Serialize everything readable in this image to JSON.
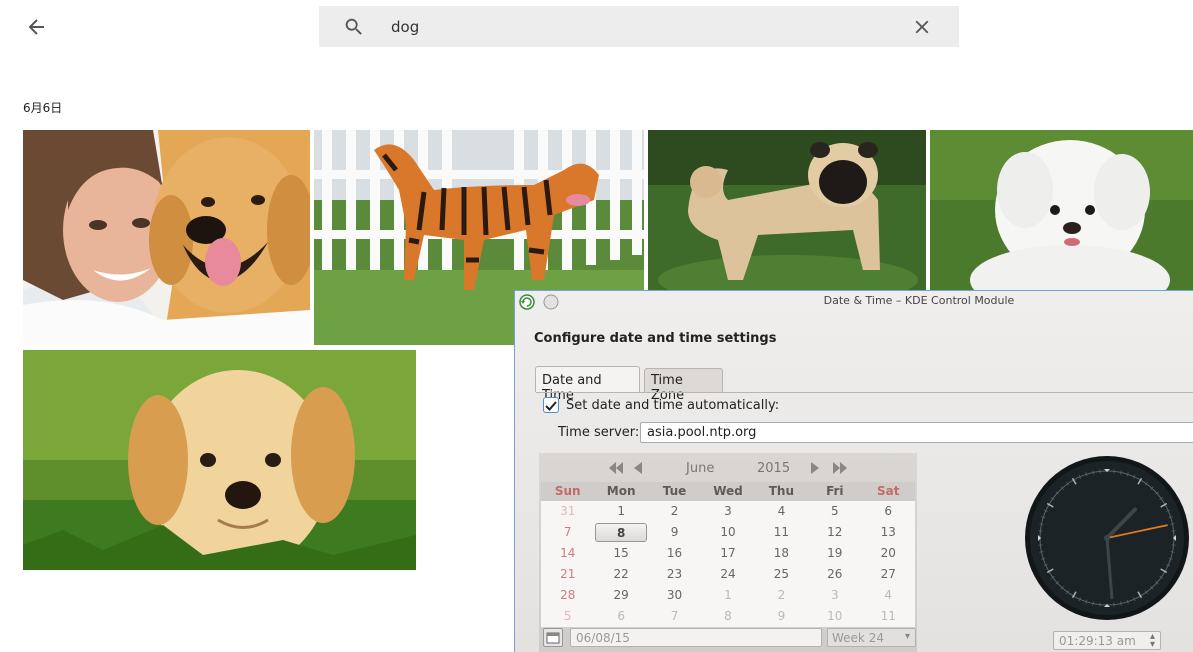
{
  "search": {
    "query": "dog",
    "placeholder": ""
  },
  "section": {
    "date_label": "6月6日"
  },
  "photos": [
    {
      "name": "woman-with-golden-retriever"
    },
    {
      "name": "tiger-striped-dog"
    },
    {
      "name": "pug"
    },
    {
      "name": "white-poodle-puppy"
    },
    {
      "name": "labrador-puppy-in-grass"
    }
  ],
  "kde": {
    "window_title": "Date & Time – KDE Control Module",
    "heading": "Configure date and time settings",
    "tabs": [
      {
        "label": "Date and Time",
        "active": true
      },
      {
        "label": "Time Zone",
        "active": false
      }
    ],
    "auto_label": "Set date and time automatically:",
    "auto_checked": true,
    "time_server_label": "Time server:",
    "time_server_value": "asia.pool.ntp.org",
    "calendar": {
      "month": "June",
      "year": "2015",
      "weekdays": [
        "Sun",
        "Mon",
        "Tue",
        "Wed",
        "Thu",
        "Fri",
        "Sat"
      ],
      "weeks": [
        [
          "31",
          "1",
          "2",
          "3",
          "4",
          "5",
          "6"
        ],
        [
          "7",
          "8",
          "9",
          "10",
          "11",
          "12",
          "13"
        ],
        [
          "14",
          "15",
          "16",
          "17",
          "18",
          "19",
          "20"
        ],
        [
          "21",
          "22",
          "23",
          "24",
          "25",
          "26",
          "27"
        ],
        [
          "28",
          "29",
          "30",
          "1",
          "2",
          "3",
          "4"
        ],
        [
          "5",
          "6",
          "7",
          "8",
          "9",
          "10",
          "11"
        ]
      ],
      "selected_day": "8",
      "date_field": "06/08/15",
      "week_label": "Week 24"
    },
    "clock": {
      "time": "01:29:13 am",
      "hour": 1,
      "minute": 29,
      "second": 13
    }
  },
  "colors": {
    "accent": "#4a8fc8",
    "weekend": "#c46a6a",
    "clock_face": "#1c2326",
    "second_hand": "#e07a1f"
  }
}
